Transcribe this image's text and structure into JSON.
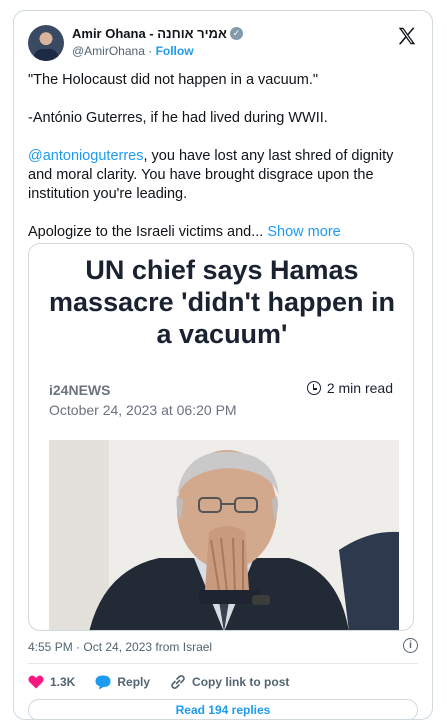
{
  "author": {
    "display_name": "Amir Ohana - אמיר אוחנה",
    "handle": "@AmirOhana",
    "separator": "·",
    "follow_label": "Follow"
  },
  "tweet": {
    "paragraph_1": "\"The Holocaust did not happen in a vacuum.\"",
    "paragraph_2": "-António Guterres, if he had lived during WWII.",
    "mention": "@antonioguterres",
    "paragraph_3_rest": ", you have lost any last shred of dignity and moral clarity. You have brought disgrace upon the institution you're leading.",
    "paragraph_4": "Apologize to the Israeli victims and...",
    "show_more_label": "Show more"
  },
  "media": {
    "headline": "UN chief says Hamas massacre 'didn't happen in a vacuum'",
    "source": "i24NEWS",
    "read_time": "2 min read",
    "date": "October 24, 2023 at 06:20 PM"
  },
  "footer": {
    "timestamp": "4:55 PM · Oct 24, 2023 from Israel",
    "likes": "1.3K",
    "reply_label": "Reply",
    "copy_link_label": "Copy link to post",
    "read_replies_label": "Read 194 replies"
  },
  "icons": {
    "verified": "verified-badge-icon",
    "brand": "x-logo-icon",
    "like": "heart-icon",
    "reply": "speech-bubble-icon",
    "copy": "link-icon",
    "info": "info-icon",
    "clock": "clock-icon"
  },
  "colors": {
    "accent": "#1d9bf0",
    "like": "#f91880",
    "verified": "#829aab",
    "secondary_text": "#536471",
    "headline": "#1a2231"
  }
}
